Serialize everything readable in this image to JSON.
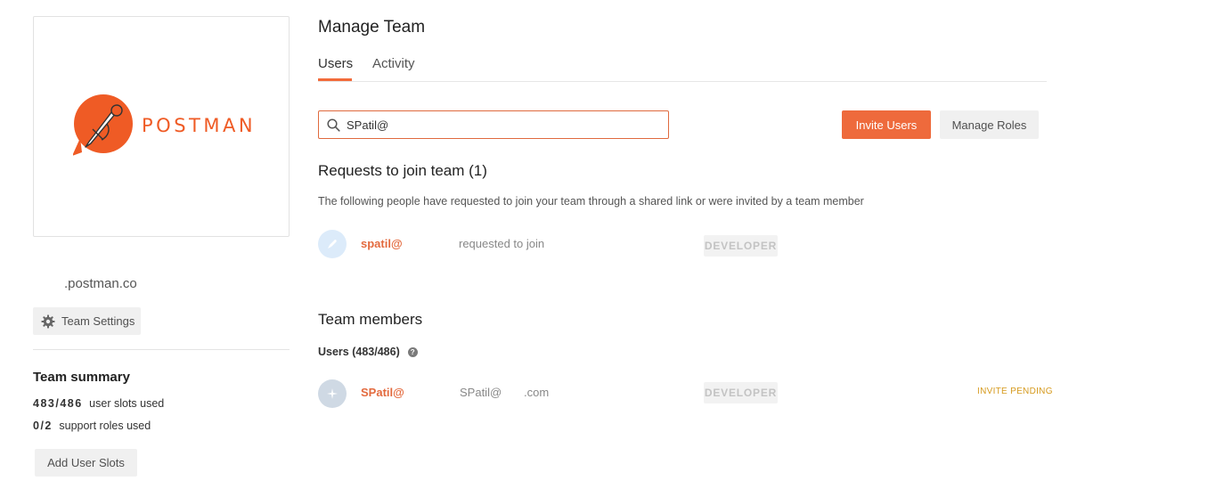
{
  "brand": {
    "logo_text": "POSTMAN",
    "accent": "#ef5b25"
  },
  "sidebar": {
    "team_domain": ".postman.co",
    "team_settings_label": "Team Settings",
    "summary_title": "Team summary",
    "user_slots_value": "483/486",
    "user_slots_text": "user slots used",
    "support_roles_value": "0/2",
    "support_roles_text": "support roles used",
    "add_slots_label": "Add User Slots"
  },
  "main": {
    "title": "Manage Team",
    "tabs": [
      {
        "label": "Users",
        "active": true
      },
      {
        "label": "Activity",
        "active": false
      }
    ],
    "search": {
      "value": "SPatil@",
      "placeholder": ""
    },
    "invite_label": "Invite Users",
    "manage_roles_label": "Manage Roles",
    "requests": {
      "title": "Requests to join team (1)",
      "description": "The following people have requested to join your team through a shared link or were invited by a team member",
      "items": [
        {
          "name": "spatil@",
          "status": "requested to join",
          "role": "DEVELOPER"
        }
      ]
    },
    "members": {
      "title": "Team members",
      "count_label": "Users (483/486)",
      "help_icon": "?",
      "items": [
        {
          "name": "SPatil@",
          "email_user": "SPatil@",
          "email_domain": ".com",
          "role": "DEVELOPER",
          "status": "INVITE PENDING"
        }
      ]
    }
  }
}
